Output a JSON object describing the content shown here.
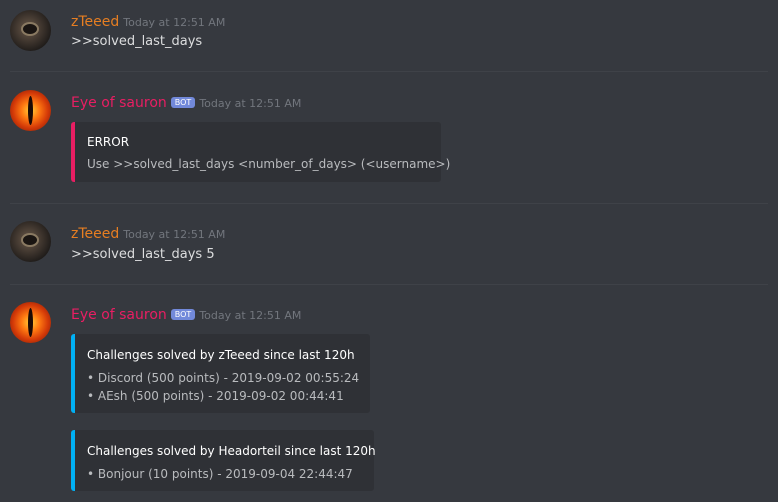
{
  "messages": [
    {
      "author": "zTeeed",
      "timestamp": "Today at 12:51 AM",
      "text": ">>solved_last_days"
    },
    {
      "author": "Eye of sauron",
      "bot_badge": "BOT",
      "timestamp": "Today at 12:51 AM",
      "embed": {
        "title": "ERROR",
        "lines": [
          "Use >>solved_last_days <number_of_days> (<username>)"
        ]
      }
    },
    {
      "author": "zTeeed",
      "timestamp": "Today at 12:51 AM",
      "text": ">>solved_last_days 5"
    },
    {
      "author": "Eye of sauron",
      "bot_badge": "BOT",
      "timestamp": "Today at 12:51 AM",
      "embeds": [
        {
          "title": "Challenges solved by zTeeed since last 120h",
          "lines": [
            "• Discord (500 points) - 2019-09-02 00:55:24",
            "• AEsh (500 points) - 2019-09-02 00:44:41"
          ]
        },
        {
          "title": "Challenges solved by Headorteil since last 120h",
          "lines": [
            "• Bonjour (10 points) - 2019-09-04 22:44:47"
          ]
        }
      ]
    }
  ],
  "colors": {
    "background": "#36393f",
    "embed_bg": "#2f3136",
    "user_name": "#e67e22",
    "bot_name": "#e91e63",
    "error_bar": "#e91e63",
    "info_bar": "#00b0f4",
    "bot_badge": "#7289da"
  },
  "icons": {
    "user_avatar": "avatar-zteeed",
    "bot_avatar": "avatar-eye-of-sauron"
  }
}
